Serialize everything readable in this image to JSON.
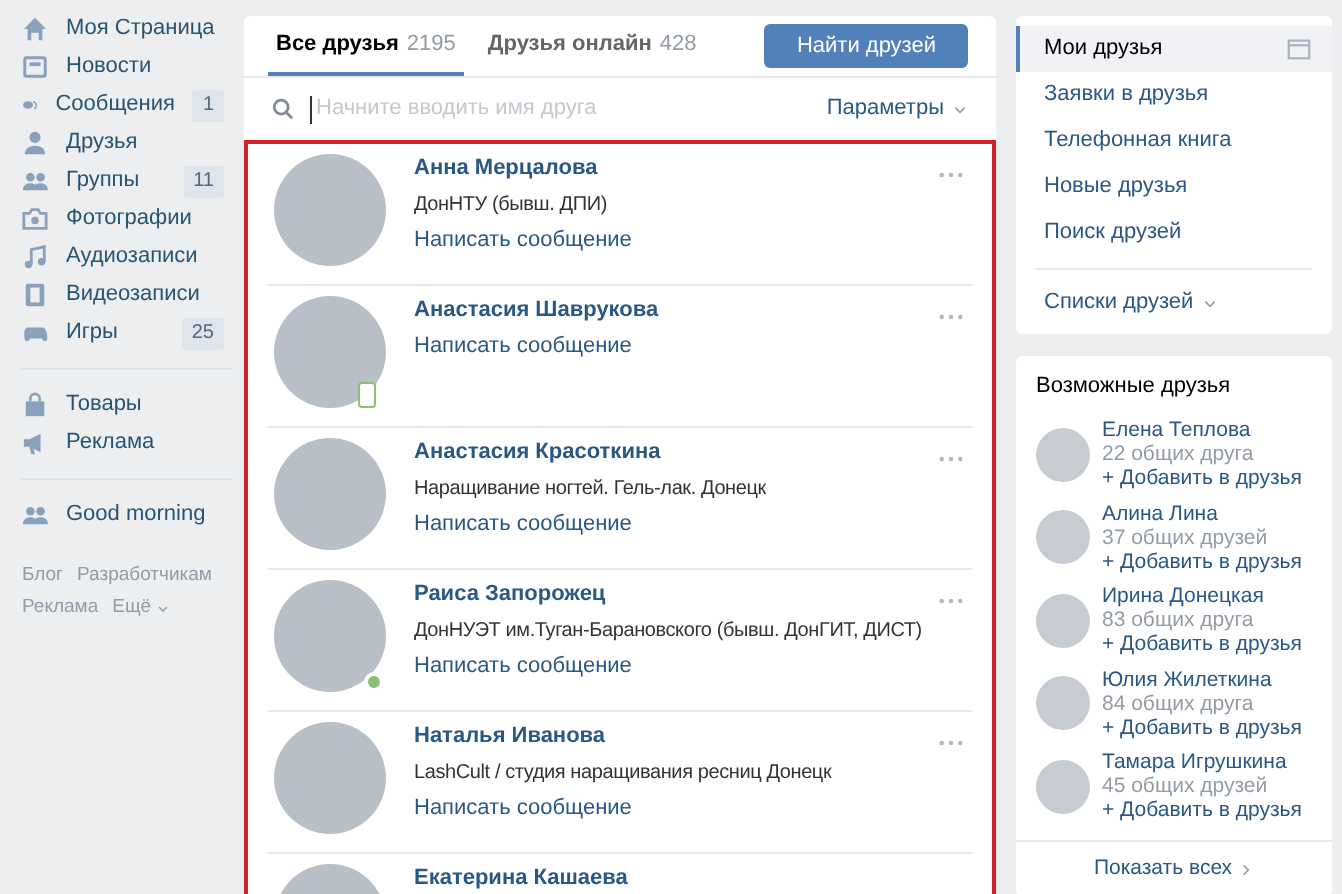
{
  "sidebar": {
    "items": [
      {
        "label": "Моя Страница"
      },
      {
        "label": "Новости"
      },
      {
        "label": "Сообщения",
        "count": "1"
      },
      {
        "label": "Друзья"
      },
      {
        "label": "Группы",
        "count": "11"
      },
      {
        "label": "Фотографии"
      },
      {
        "label": "Аудиозаписи"
      },
      {
        "label": "Видеозаписи"
      },
      {
        "label": "Игры",
        "count": "25"
      }
    ],
    "extra_items": [
      {
        "label": "Товары"
      },
      {
        "label": "Реклама"
      }
    ],
    "community_items": [
      {
        "label": "Good morning"
      }
    ],
    "footer_links": [
      "Блог",
      "Разработчикам",
      "Реклама",
      "Ещё"
    ]
  },
  "tabs": [
    {
      "label": "Все друзья",
      "count": "2195",
      "selected": true
    },
    {
      "label": "Друзья онлайн",
      "count": "428",
      "selected": false
    }
  ],
  "find_button": "Найти друзей",
  "search": {
    "placeholder": "Начните вводить имя друга"
  },
  "params_button": "Параметры",
  "friends": [
    {
      "name": "Анна Мерцалова",
      "info": "ДонНТУ (бывш. ДПИ)",
      "action": "Написать сообщение",
      "online": false,
      "mobile": false
    },
    {
      "name": "Анастасия Шаврукова",
      "action": "Написать сообщение",
      "online": true,
      "mobile": true
    },
    {
      "name": "Анастасия Красоткина",
      "info": "Наращивание ногтей. Гель-лак. Донецк",
      "action": "Написать сообщение",
      "online": false,
      "mobile": false
    },
    {
      "name": "Раиса Запорожец",
      "info": "ДонНУЭТ им.Туган-Барановского (бывш. ДонГИТ, ДИСТ)",
      "action": "Написать сообщение",
      "online": true,
      "mobile": false
    },
    {
      "name": "Наталья Иванова",
      "info": "LashCult / студия наращивания ресниц Донецк",
      "action": "Написать сообщение",
      "online": false,
      "mobile": false
    },
    {
      "name": "Екатерина Кашаева"
    }
  ],
  "nav": {
    "items": [
      {
        "label": "Мои друзья",
        "selected": true
      },
      {
        "label": "Заявки в друзья",
        "selected": false
      },
      {
        "label": "Телефонная книга",
        "selected": false
      },
      {
        "label": "Новые друзья",
        "selected": false
      },
      {
        "label": "Поиск друзей",
        "selected": false
      }
    ],
    "lists_label": "Списки друзей"
  },
  "suggestions": {
    "title": "Возможные друзья",
    "items": [
      {
        "name": "Елена Теплова",
        "mutual": "22 общих друга",
        "action": "+ Добавить в друзья"
      },
      {
        "name": "Алина Лина",
        "mutual": "37 общих друзей",
        "action": "+ Добавить в друзья"
      },
      {
        "name": "Ирина Донецкая",
        "mutual": "83 общих друга",
        "action": "+ Добавить в друзья"
      },
      {
        "name": "Юлия Жилеткина",
        "mutual": "84 общих друга",
        "action": "+ Добавить в друзья"
      },
      {
        "name": "Тамара Игрушкина",
        "mutual": "45 общих друзей",
        "action": "+ Добавить в друзья"
      }
    ],
    "show_all": "Показать всех"
  }
}
